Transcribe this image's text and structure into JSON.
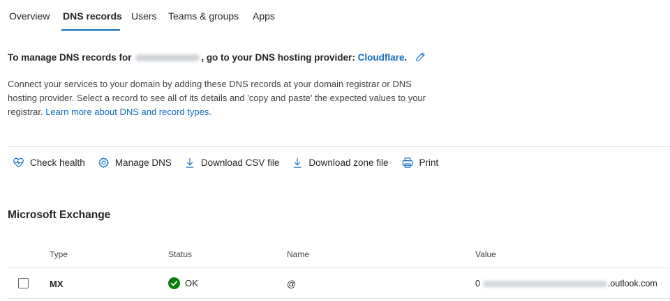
{
  "tabs": [
    {
      "label": "Overview"
    },
    {
      "label": "DNS records"
    },
    {
      "label": "Users"
    },
    {
      "label": "Teams & groups"
    },
    {
      "label": "Apps"
    }
  ],
  "active_tab": "DNS records",
  "heading": {
    "prefix": "To manage DNS records for",
    "middle": ", go to your DNS hosting provider:",
    "provider": "Cloudflare",
    "suffix": "."
  },
  "description": {
    "text": "Connect your services to your domain by adding these DNS records at your domain registrar or DNS hosting provider. Select a record to see all of its details and 'copy and paste' the expected values to your registrar.",
    "link": "Learn more about DNS and record types."
  },
  "toolbar": {
    "check_health": "Check health",
    "manage_dns": "Manage DNS",
    "download_csv": "Download CSV file",
    "download_zone": "Download zone file",
    "print": "Print"
  },
  "section": {
    "title": "Microsoft Exchange"
  },
  "table": {
    "headers": {
      "type": "Type",
      "status": "Status",
      "name": "Name",
      "value": "Value"
    },
    "rows": [
      {
        "type": "MX",
        "status": "OK",
        "name": "@",
        "value_prefix": "0",
        "value_suffix": ".outlook.com"
      }
    ]
  },
  "colors": {
    "accent": "#0f6cbd",
    "ok_green": "#107c10"
  }
}
